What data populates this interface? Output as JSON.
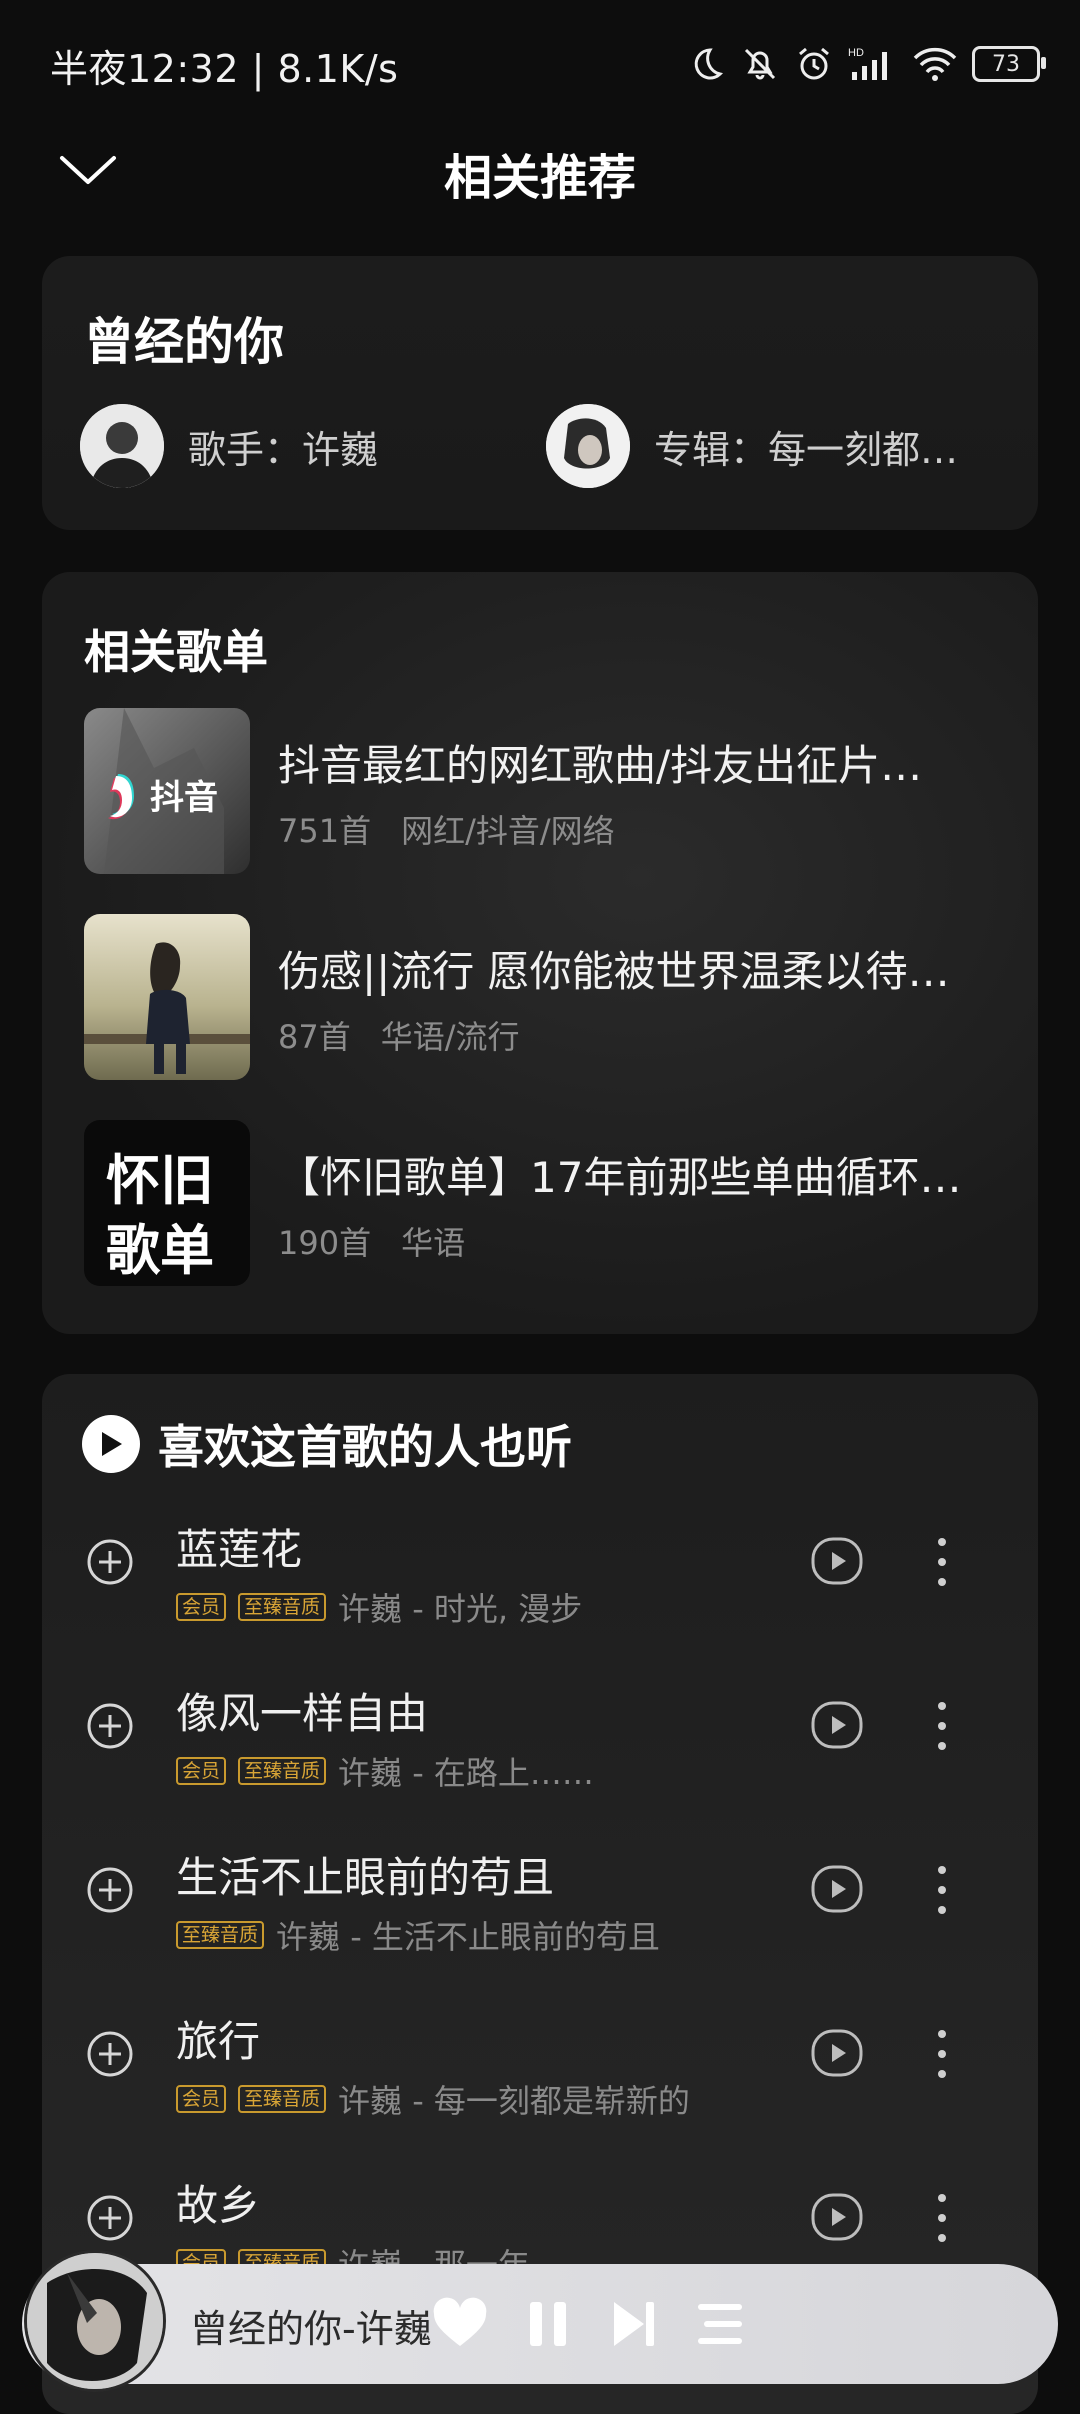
{
  "status": {
    "time": "半夜12:32 | 8.1K/s",
    "battery": "73"
  },
  "header": {
    "title": "相关推荐"
  },
  "song_info": {
    "title": "曾经的你",
    "artist_label": "歌手：许巍",
    "album_label": "专辑：每一刻都…"
  },
  "playlists": {
    "title": "相关歌单",
    "items": [
      {
        "title": "抖音最红的网红歌曲/抖友出征片…",
        "count": "751首",
        "tags": "网红/抖音/网络",
        "thumb_text": "抖音"
      },
      {
        "title": "伤感||流行  愿你能被世界温柔以待…",
        "count": "87首",
        "tags": "华语/流行"
      },
      {
        "title": "【怀旧歌单】17年前那些单曲循环…",
        "count": "190首",
        "tags": "华语",
        "thumb_text_1": "怀旧",
        "thumb_text_2": "歌单"
      }
    ]
  },
  "similar": {
    "title": "喜欢这首歌的人也听",
    "songs": [
      {
        "title": "蓝莲花",
        "badges": [
          "会员",
          "至臻音质"
        ],
        "meta": "许巍 - 时光, 漫步"
      },
      {
        "title": "像风一样自由",
        "badges": [
          "会员",
          "至臻音质"
        ],
        "meta": "许巍 - 在路上……"
      },
      {
        "title": "生活不止眼前的苟且",
        "badges": [
          "至臻音质"
        ],
        "meta": "许巍 - 生活不止眼前的苟且"
      },
      {
        "title": "旅行",
        "badges": [
          "会员",
          "至臻音质"
        ],
        "meta": "许巍 - 每一刻都是崭新的"
      },
      {
        "title": "故乡",
        "badges": [
          "会员",
          "至臻音质"
        ],
        "meta": "许巍 - 那一年"
      }
    ]
  },
  "player": {
    "now_playing": "曾经的你-许巍"
  }
}
